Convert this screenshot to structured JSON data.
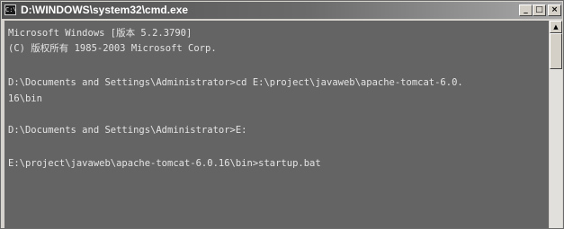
{
  "window": {
    "title": "D:\\WINDOWS\\system32\\cmd.exe",
    "icon": "cmd-icon",
    "buttons": {
      "minimize": "_",
      "maximize": "□",
      "close": "×"
    }
  },
  "console": {
    "lines": [
      "Microsoft Windows [版本 5.2.3790]",
      "(C) 版权所有 1985-2003 Microsoft Corp.",
      "D:\\Documents and Settings\\Administrator>cd E:\\project\\javaweb\\apache-tomcat-6.0.",
      "16\\bin",
      "D:\\Documents and Settings\\Administrator>E:",
      "E:\\project\\javaweb\\apache-tomcat-6.0.16\\bin>startup.bat"
    ]
  },
  "colors": {
    "console_bg": "#646464",
    "console_text": "#e4e4e4",
    "titlebar": "#5a5a5a"
  }
}
